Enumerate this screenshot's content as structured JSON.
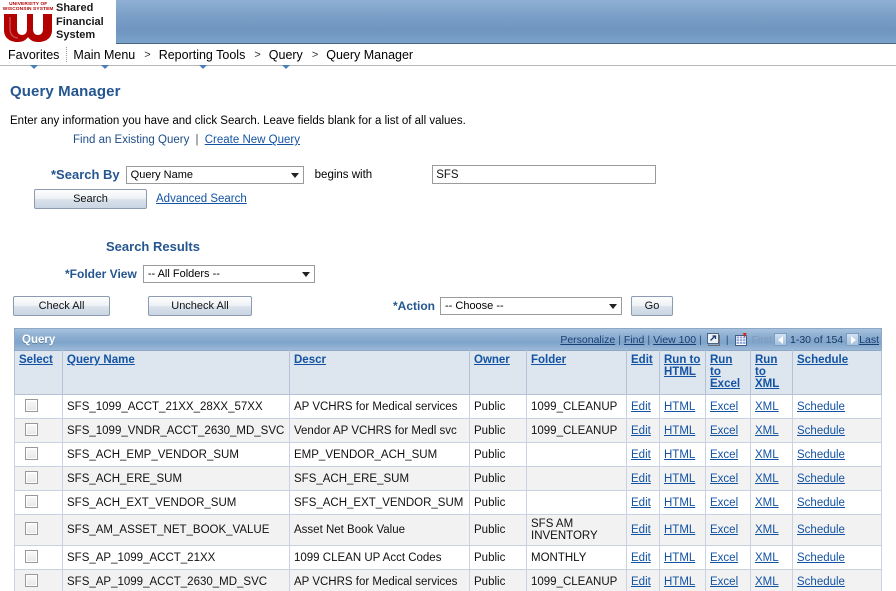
{
  "brand": {
    "logo_top_line1": "UNIVERSITY OF",
    "logo_top_line2": "WISCONSIN SYSTEM",
    "logo_mark": "UW",
    "app_title_line1": "Shared",
    "app_title_line2": "Financial",
    "app_title_line3": "System",
    "header_color": "#7ba0c8",
    "logo_red": "#b30000"
  },
  "breadcrumb": {
    "favorites": "Favorites",
    "items": [
      {
        "label": "Main Menu",
        "has_caret": true
      },
      {
        "label": "Reporting Tools",
        "has_caret": true
      },
      {
        "label": "Query",
        "has_caret": true
      },
      {
        "label": "Query Manager",
        "has_caret": false
      }
    ],
    "separator": ">"
  },
  "page": {
    "title": "Query Manager",
    "instructions": "Enter any information you have and click Search. Leave fields blank for a list of all values.",
    "tab_current": "Find an Existing Query",
    "tab_separator": "|",
    "tab_link": "Create New Query"
  },
  "search": {
    "search_by_label": "*Search By",
    "search_by_value": "Query Name",
    "operator_label": "begins with",
    "value": "SFS",
    "value_placeholder": "",
    "search_button": "Search",
    "advanced_search": "Advanced Search"
  },
  "results": {
    "heading": "Search Results",
    "folder_view_label": "*Folder View",
    "folder_view_value": "-- All Folders --",
    "check_all": "Check All",
    "uncheck_all": "Uncheck All",
    "action_label": "*Action",
    "action_value": "-- Choose --",
    "go_button": "Go"
  },
  "grid": {
    "title": "Query",
    "nav": {
      "personalize": "Personalize",
      "find": "Find",
      "view_100": "View 100",
      "zoom_icon": "expand-grid-icon",
      "download_icon": "download-to-spreadsheet-icon",
      "first": "First",
      "prev_icon": "previous-page-icon",
      "counter": "1-30 of 154",
      "next_icon": "next-page-icon",
      "last": "Last"
    },
    "columns": [
      "Select",
      "Query Name",
      "Descr",
      "Owner",
      "Folder",
      "Edit",
      "Run to HTML",
      "Run to Excel",
      "Run to XML",
      "Schedule"
    ],
    "row_links": {
      "edit": "Edit",
      "html": "HTML",
      "excel": "Excel",
      "xml": "XML",
      "schedule": "Schedule"
    },
    "rows": [
      {
        "name": "SFS_1099_ACCT_21XX_28XX_57XX",
        "descr": "AP VCHRS for Medical services",
        "owner": "Public",
        "folder": "1099_CLEANUP"
      },
      {
        "name": "SFS_1099_VNDR_ACCT_2630_MD_SVC",
        "descr": "Vendor AP VCHRS for Medl svc",
        "owner": "Public",
        "folder": "1099_CLEANUP"
      },
      {
        "name": "SFS_ACH_EMP_VENDOR_SUM",
        "descr": "EMP_VENDOR_ACH_SUM",
        "owner": "Public",
        "folder": ""
      },
      {
        "name": "SFS_ACH_ERE_SUM",
        "descr": "SFS_ACH_ERE_SUM",
        "owner": "Public",
        "folder": ""
      },
      {
        "name": "SFS_ACH_EXT_VENDOR_SUM",
        "descr": "SFS_ACH_EXT_VENDOR_SUM",
        "owner": "Public",
        "folder": ""
      },
      {
        "name": "SFS_AM_ASSET_NET_BOOK_VALUE",
        "descr": "Asset Net Book Value",
        "owner": "Public",
        "folder": "SFS AM INVENTORY"
      },
      {
        "name": "SFS_AP_1099_ACCT_21XX",
        "descr": "1099 CLEAN UP Acct Codes",
        "owner": "Public",
        "folder": "MONTHLY"
      },
      {
        "name": "SFS_AP_1099_ACCT_2630_MD_SVC",
        "descr": "AP VCHRS for Medical services",
        "owner": "Public",
        "folder": "1099_CLEANUP"
      }
    ]
  }
}
